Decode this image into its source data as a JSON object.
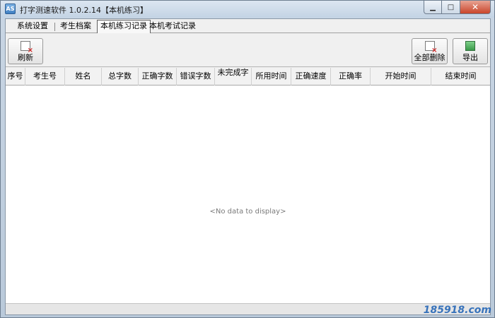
{
  "window": {
    "app_icon_text": "AS",
    "title": "打字测速软件  1.0.2.14【本机练习】"
  },
  "tabs": [
    {
      "label": "系统设置"
    },
    {
      "label": "考生档案"
    },
    {
      "label": "本机练习记录"
    },
    {
      "label": "本机考试记录"
    }
  ],
  "toolbar": {
    "refresh_label": "刷新",
    "delete_all_label": "全部删除",
    "export_label": "导出"
  },
  "grid": {
    "columns": [
      "序号",
      "考生号",
      "姓名",
      "总字数",
      "正确字数",
      "错误字数",
      "未完成字",
      "所用时间",
      "正确速度",
      "正确率",
      "开始时间",
      "结束时间"
    ],
    "empty_text": "<No data to display>"
  },
  "watermark": "185918.com"
}
